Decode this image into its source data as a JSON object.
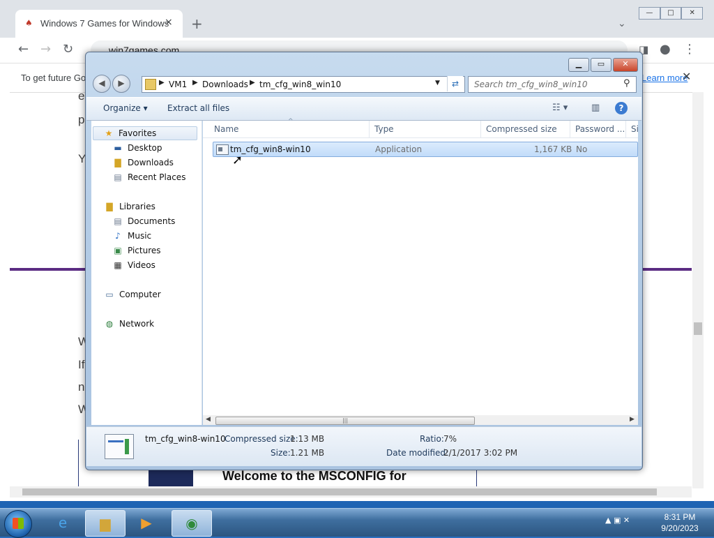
{
  "browser": {
    "tab_title": "Windows 7 Games for Windows",
    "tab_close": "×",
    "new_tab": "+",
    "url": "win7games.com",
    "infobar_message": "To get future Go",
    "infobar_link": "Learn more",
    "infobar_close": "✕",
    "page_fragments": [
      "e",
      "p",
      "Y",
      "W",
      "If",
      "n",
      "W"
    ],
    "banner_text": "Welcome to the MSCONFIG for"
  },
  "explorer": {
    "breadcrumb": [
      "VM1",
      "Downloads",
      "tm_cfg_win8_win10"
    ],
    "search_placeholder": "Search tm_cfg_win8_win10",
    "commands": {
      "organize": "Organize",
      "extract_all": "Extract all files"
    },
    "favorites": {
      "header": "Favorites",
      "items": [
        "Desktop",
        "Downloads",
        "Recent Places"
      ]
    },
    "libraries": {
      "header": "Libraries",
      "items": [
        "Documents",
        "Music",
        "Pictures",
        "Videos"
      ]
    },
    "computer": "Computer",
    "network": "Network",
    "columns": [
      "Name",
      "Type",
      "Compressed size",
      "Password ...",
      "Si"
    ],
    "files": [
      {
        "name": "tm_cfg_win8-win10",
        "type": "Application",
        "compressed_size": "1,167 KB",
        "password": "No"
      }
    ],
    "details": {
      "name": "tm_cfg_win8-win10",
      "compressed_size_label": "Compressed size:",
      "compressed_size": "1.13 MB",
      "size_label": "Size:",
      "size": "1.21 MB",
      "ratio_label": "Ratio:",
      "ratio": "7%",
      "date_label": "Date modified:",
      "date": "2/1/2017 3:02 PM"
    }
  },
  "taskbar": {
    "time": "8:31 PM",
    "date": "9/20/2023"
  }
}
